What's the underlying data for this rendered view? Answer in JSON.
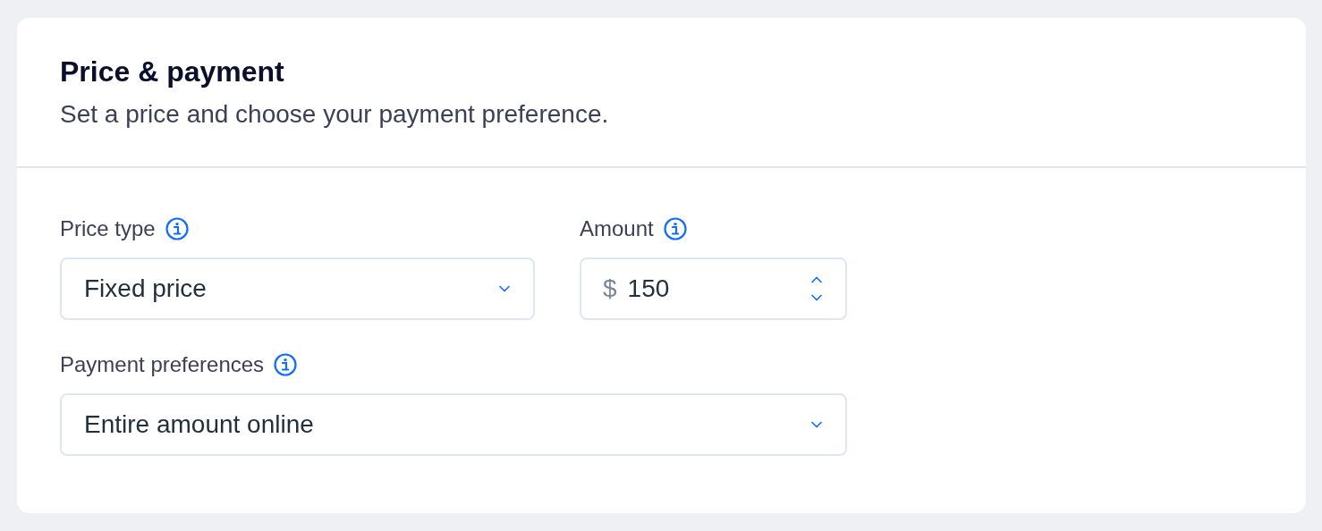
{
  "card": {
    "title": "Price & payment",
    "subtitle": "Set a price and choose your payment preference."
  },
  "fields": [
    {
      "kind": "dropdown",
      "label": "Price type",
      "value": "Fixed price"
    },
    {
      "kind": "number",
      "label": "Amount",
      "prefix": "$",
      "value": "150"
    },
    {
      "kind": "dropdown",
      "label": "Payment preferences",
      "value": "Entire amount online"
    }
  ]
}
